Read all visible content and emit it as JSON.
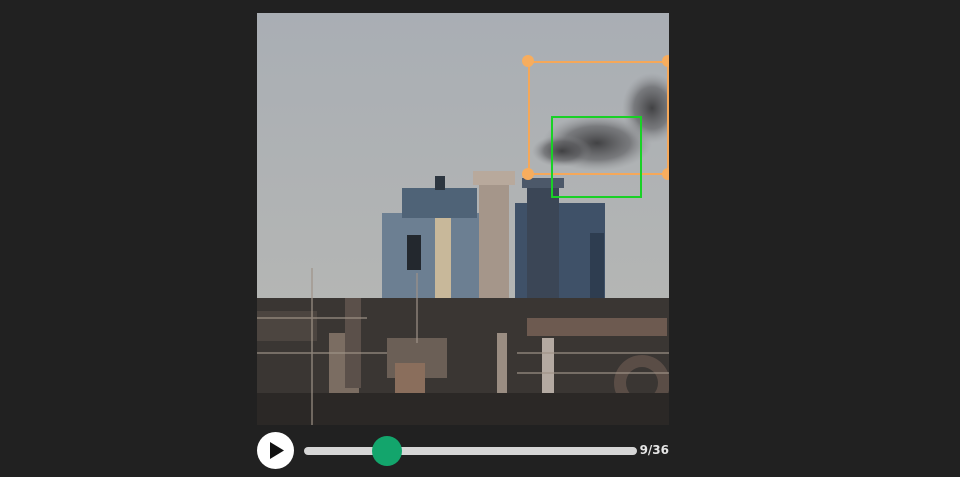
{
  "player": {
    "play_icon": "play-icon",
    "current_frame": 9,
    "total_frames": 36,
    "frame_counter": "9/36",
    "progress_fraction": 0.25
  },
  "annotations": {
    "selected_box_color": "#f5a85a",
    "detection_box_color": "#19d126"
  },
  "colors": {
    "background": "#212121",
    "slider_thumb": "#13a56c",
    "slider_track": "#d6d6d6"
  }
}
